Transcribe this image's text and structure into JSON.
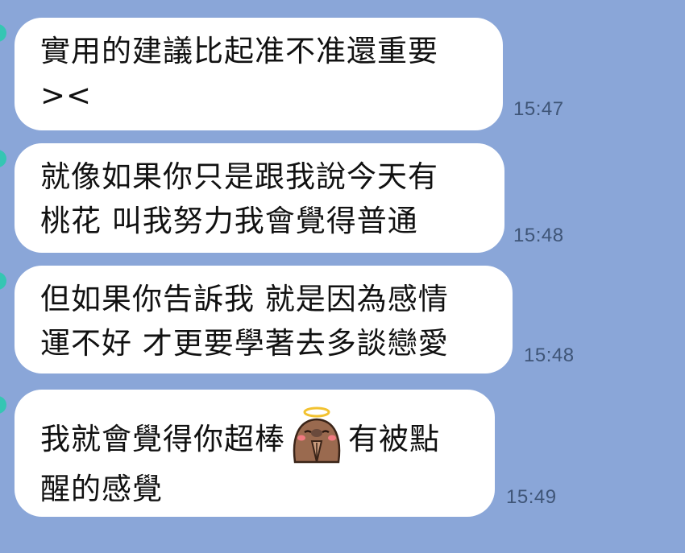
{
  "messages": [
    {
      "lines": [
        "實用的建議比起准不准還重要",
        "><"
      ],
      "time": "15:47"
    },
    {
      "lines": [
        "就像如果你只是跟我說今天有",
        "桃花 叫我努力我會覺得普通"
      ],
      "time": "15:48"
    },
    {
      "lines": [
        "但如果你告訴我 就是因為感情",
        "運不好 才更要學著去多談戀愛"
      ],
      "time": "15:48"
    },
    {
      "line1_before_sticker": "我就會覺得你超棒",
      "line1_after_sticker": "有被點",
      "line2": "醒的感覺",
      "sticker_icon": "praying-angel-sticker",
      "time": "15:49"
    }
  ],
  "colors": {
    "background": "#8aa6d8",
    "bubble": "#ffffff",
    "timestamp": "#3f5577",
    "avatar_accent": "#35c6b3"
  }
}
